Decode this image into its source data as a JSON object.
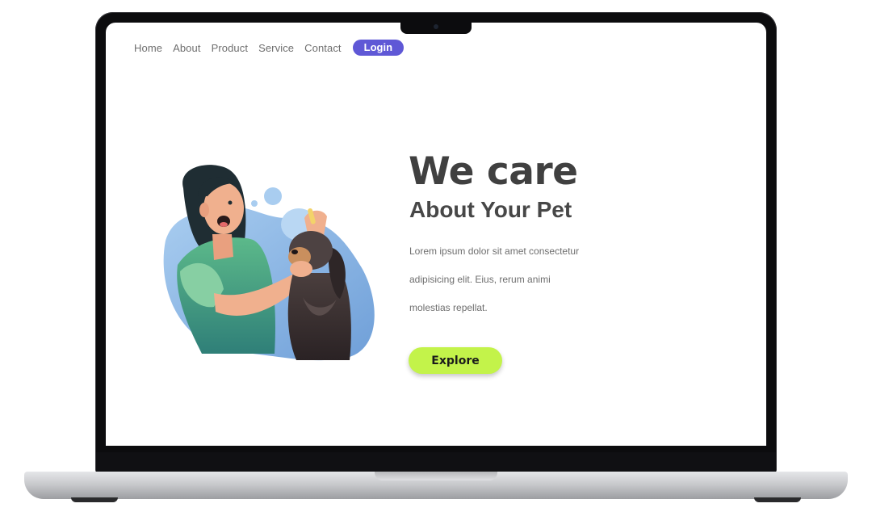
{
  "nav": {
    "links": [
      "Home",
      "About",
      "Product",
      "Service",
      "Contact"
    ],
    "login_label": "Login"
  },
  "hero": {
    "title": "We care",
    "subtitle": "About Your Pet",
    "body_lines": [
      "Lorem ipsum dolor sit amet consectetur",
      "adipisicing elit. Eius, rerum animi",
      "molestias repellat."
    ],
    "cta_label": "Explore"
  },
  "colors": {
    "login_button": "#5f58d6",
    "explore_button": "#c3f34a",
    "heading_text": "#404040",
    "blob_blue": "#8fb9e4",
    "shirt_green": "#4fa37f",
    "hair": "#1f2d33",
    "dog": "#3e3434"
  },
  "illustration": {
    "icon": "woman-grooming-dog-illustration"
  }
}
